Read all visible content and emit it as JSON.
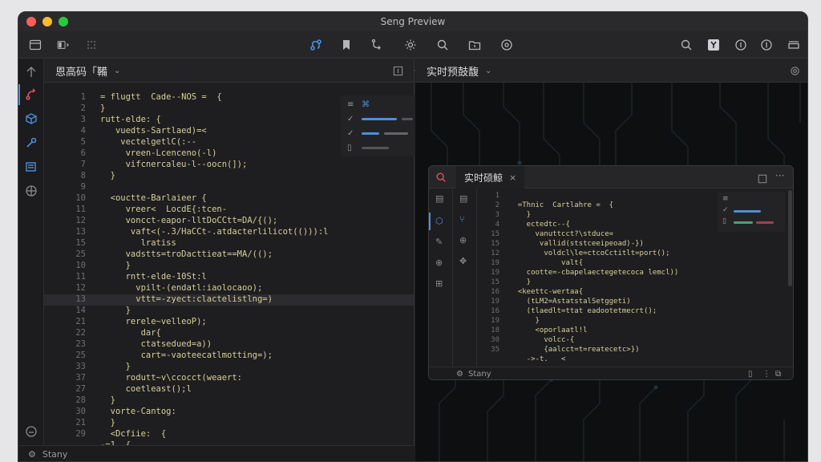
{
  "window": {
    "title": "Seng Preview"
  },
  "editor": {
    "tab_label": "恩高码「鞴",
    "lines": [
      {
        "n": "1",
        "code": "= flugtt  Cade--NOS =  {"
      },
      {
        "n": "2",
        "code": "}"
      },
      {
        "n": "3",
        "code": "rutt-elde: {"
      },
      {
        "n": "4",
        "code": "   vuedts-Sartlaed)=<"
      },
      {
        "n": "5",
        "code": "    vectelgetlC(:--"
      },
      {
        "n": "6",
        "code": "     vreen-Lcenceno(-l)"
      },
      {
        "n": "7",
        "code": "     vifcnercaleu-l--oocn(]);"
      },
      {
        "n": "8",
        "code": "  }"
      },
      {
        "n": "9",
        "code": ""
      },
      {
        "n": "10",
        "code": "  <ouctte-Barlaieer {"
      },
      {
        "n": "11",
        "code": "     vreer<  LocdE{:tcen-"
      },
      {
        "n": "12",
        "code": "     voncct-eapor-lltDoCCtt=DA/{();"
      },
      {
        "n": "13",
        "code": "      vaft<(-.3/HaCCt-.atdacterlilicot(())):l"
      },
      {
        "n": "15",
        "code": "        lratiss"
      },
      {
        "n": "25",
        "code": "     vadstts=troDacttieat==MA/(();"
      },
      {
        "n": "10",
        "code": "     }"
      },
      {
        "n": "11",
        "code": "     rntt-elde-10St:l"
      },
      {
        "n": "12",
        "code": "       vpilt-(endatl:iaolocaoo);"
      },
      {
        "n": "13",
        "code": "       vttt=-zyect:clactelistlng=)"
      },
      {
        "n": "14",
        "code": "     }"
      },
      {
        "n": "21",
        "code": "     rerele~velleoP);"
      },
      {
        "n": "22",
        "code": "        dar{"
      },
      {
        "n": "23",
        "code": "        ctatsedued=a))"
      },
      {
        "n": "25",
        "code": "        cart=-vaoteecatlmotting=);"
      },
      {
        "n": "33",
        "code": "     }"
      },
      {
        "n": "37",
        "code": "     rodutt~v\\ccocct(weaert:"
      },
      {
        "n": "27",
        "code": "     coetleast();l"
      },
      {
        "n": "28",
        "code": "  }"
      },
      {
        "n": "30",
        "code": "  vorte-Cantog:"
      },
      {
        "n": "21",
        "code": "  }"
      },
      {
        "n": "29",
        "code": "  <Dcfiie:  {"
      },
      {
        "n": "",
        "code": "-=1  {"
      }
    ],
    "highlight_index": 18,
    "status_label": "Stany"
  },
  "preview": {
    "tab_label": "实时预鼓馥",
    "inner": {
      "tab_label": "实时硕鯨",
      "status_label": "Stany",
      "lines": [
        {
          "n": "1",
          "code": ""
        },
        {
          "n": "2",
          "code": "  =Thnic  Cartlahre =  {"
        },
        {
          "n": "3",
          "code": "    }"
        },
        {
          "n": "4",
          "code": "    ectedtc--{"
        },
        {
          "n": "15",
          "code": "      vanuttcct?\\stduce="
        },
        {
          "n": "15",
          "code": "       vallid(ststceeipeoad)-})"
        },
        {
          "n": "12",
          "code": "        voldcl\\le=ctcoCctitlt=port();"
        },
        {
          "n": "19",
          "code": "            valt{"
        },
        {
          "n": "19",
          "code": "    cootte=-cbapelaectegetecoca lemcl))"
        },
        {
          "n": "15",
          "code": "    }"
        },
        {
          "n": "16",
          "code": "  <keettc-wertaa{"
        },
        {
          "n": "19",
          "code": "    (tLM2=AstatstalSetggeti)"
        },
        {
          "n": "16",
          "code": "    (tlaedlt=ttat eadootetmecrt();"
        },
        {
          "n": "19",
          "code": "      }"
        },
        {
          "n": "18",
          "code": "      <oporlaatl!l"
        },
        {
          "n": "30",
          "code": "        volcc-{"
        },
        {
          "n": "35",
          "code": "        {aalcct=t=reatecetc>})"
        },
        {
          "n": "",
          "code": "    ->-t.   <"
        }
      ]
    }
  },
  "colors": {
    "accent": "#4a8fe0",
    "code": "#d6cf9a",
    "active_icon": "#e0505a"
  }
}
